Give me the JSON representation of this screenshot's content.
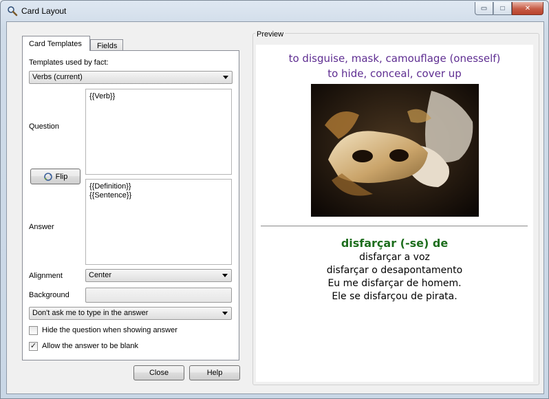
{
  "window": {
    "title": "Card Layout",
    "controls": {
      "minimize": "▭",
      "maximize": "□",
      "close": "✕"
    }
  },
  "tabs": [
    {
      "label": "Card Templates",
      "active": true
    },
    {
      "label": "Fields",
      "active": false
    }
  ],
  "templates": {
    "label": "Templates used by fact:",
    "selected": "Verbs (current)"
  },
  "question": {
    "label": "Question",
    "template": "{{Verb}}"
  },
  "flip_button": "Flip",
  "answer": {
    "label": "Answer",
    "template": "{{Definition}}\n{{Sentence}}"
  },
  "alignment": {
    "label": "Alignment",
    "selected": "Center"
  },
  "background": {
    "label": "Background",
    "value": ""
  },
  "type_answer": {
    "selected": "Don't ask me to type in the answer"
  },
  "options": [
    {
      "label": "Hide the question when showing answer",
      "checked": false
    },
    {
      "label": "Allow the answer to be blank",
      "checked": true
    }
  ],
  "buttons": {
    "close": "Close",
    "help": "Help"
  },
  "preview": {
    "label": "Preview",
    "question_lines": [
      "to disguise, mask, camouflage (onesself)",
      "to hide, conceal, cover up"
    ],
    "answer_heading": "disfarçar (-se) de",
    "answer_lines": [
      "disfarçar a voz",
      "disfarçar o desapontamento",
      "Eu me disfarçar de homem.",
      "Ele se disfarçou de pirata."
    ],
    "question_color": "#5e2d91",
    "answer_heading_color": "#1e6e1e"
  }
}
